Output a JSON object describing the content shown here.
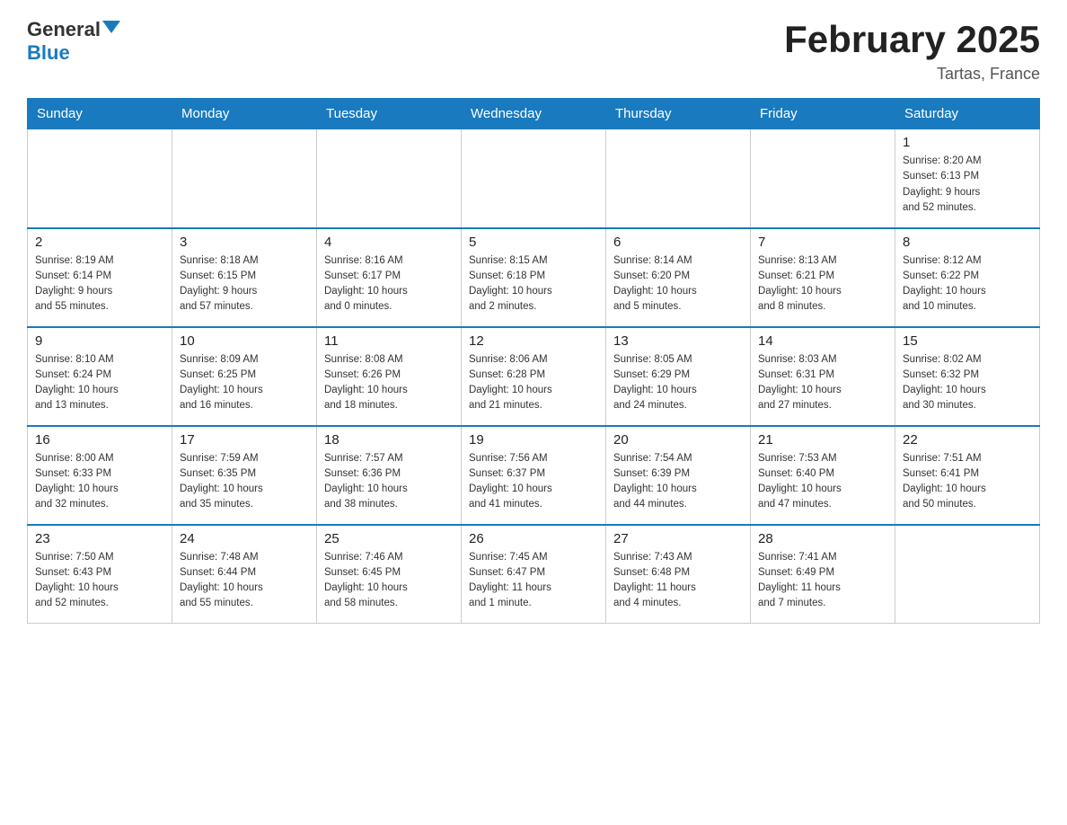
{
  "header": {
    "logo_general": "General",
    "logo_blue": "Blue",
    "month_title": "February 2025",
    "location": "Tartas, France"
  },
  "days_of_week": [
    "Sunday",
    "Monday",
    "Tuesday",
    "Wednesday",
    "Thursday",
    "Friday",
    "Saturday"
  ],
  "weeks": [
    [
      {
        "day": "",
        "info": ""
      },
      {
        "day": "",
        "info": ""
      },
      {
        "day": "",
        "info": ""
      },
      {
        "day": "",
        "info": ""
      },
      {
        "day": "",
        "info": ""
      },
      {
        "day": "",
        "info": ""
      },
      {
        "day": "1",
        "info": "Sunrise: 8:20 AM\nSunset: 6:13 PM\nDaylight: 9 hours\nand 52 minutes."
      }
    ],
    [
      {
        "day": "2",
        "info": "Sunrise: 8:19 AM\nSunset: 6:14 PM\nDaylight: 9 hours\nand 55 minutes."
      },
      {
        "day": "3",
        "info": "Sunrise: 8:18 AM\nSunset: 6:15 PM\nDaylight: 9 hours\nand 57 minutes."
      },
      {
        "day": "4",
        "info": "Sunrise: 8:16 AM\nSunset: 6:17 PM\nDaylight: 10 hours\nand 0 minutes."
      },
      {
        "day": "5",
        "info": "Sunrise: 8:15 AM\nSunset: 6:18 PM\nDaylight: 10 hours\nand 2 minutes."
      },
      {
        "day": "6",
        "info": "Sunrise: 8:14 AM\nSunset: 6:20 PM\nDaylight: 10 hours\nand 5 minutes."
      },
      {
        "day": "7",
        "info": "Sunrise: 8:13 AM\nSunset: 6:21 PM\nDaylight: 10 hours\nand 8 minutes."
      },
      {
        "day": "8",
        "info": "Sunrise: 8:12 AM\nSunset: 6:22 PM\nDaylight: 10 hours\nand 10 minutes."
      }
    ],
    [
      {
        "day": "9",
        "info": "Sunrise: 8:10 AM\nSunset: 6:24 PM\nDaylight: 10 hours\nand 13 minutes."
      },
      {
        "day": "10",
        "info": "Sunrise: 8:09 AM\nSunset: 6:25 PM\nDaylight: 10 hours\nand 16 minutes."
      },
      {
        "day": "11",
        "info": "Sunrise: 8:08 AM\nSunset: 6:26 PM\nDaylight: 10 hours\nand 18 minutes."
      },
      {
        "day": "12",
        "info": "Sunrise: 8:06 AM\nSunset: 6:28 PM\nDaylight: 10 hours\nand 21 minutes."
      },
      {
        "day": "13",
        "info": "Sunrise: 8:05 AM\nSunset: 6:29 PM\nDaylight: 10 hours\nand 24 minutes."
      },
      {
        "day": "14",
        "info": "Sunrise: 8:03 AM\nSunset: 6:31 PM\nDaylight: 10 hours\nand 27 minutes."
      },
      {
        "day": "15",
        "info": "Sunrise: 8:02 AM\nSunset: 6:32 PM\nDaylight: 10 hours\nand 30 minutes."
      }
    ],
    [
      {
        "day": "16",
        "info": "Sunrise: 8:00 AM\nSunset: 6:33 PM\nDaylight: 10 hours\nand 32 minutes."
      },
      {
        "day": "17",
        "info": "Sunrise: 7:59 AM\nSunset: 6:35 PM\nDaylight: 10 hours\nand 35 minutes."
      },
      {
        "day": "18",
        "info": "Sunrise: 7:57 AM\nSunset: 6:36 PM\nDaylight: 10 hours\nand 38 minutes."
      },
      {
        "day": "19",
        "info": "Sunrise: 7:56 AM\nSunset: 6:37 PM\nDaylight: 10 hours\nand 41 minutes."
      },
      {
        "day": "20",
        "info": "Sunrise: 7:54 AM\nSunset: 6:39 PM\nDaylight: 10 hours\nand 44 minutes."
      },
      {
        "day": "21",
        "info": "Sunrise: 7:53 AM\nSunset: 6:40 PM\nDaylight: 10 hours\nand 47 minutes."
      },
      {
        "day": "22",
        "info": "Sunrise: 7:51 AM\nSunset: 6:41 PM\nDaylight: 10 hours\nand 50 minutes."
      }
    ],
    [
      {
        "day": "23",
        "info": "Sunrise: 7:50 AM\nSunset: 6:43 PM\nDaylight: 10 hours\nand 52 minutes."
      },
      {
        "day": "24",
        "info": "Sunrise: 7:48 AM\nSunset: 6:44 PM\nDaylight: 10 hours\nand 55 minutes."
      },
      {
        "day": "25",
        "info": "Sunrise: 7:46 AM\nSunset: 6:45 PM\nDaylight: 10 hours\nand 58 minutes."
      },
      {
        "day": "26",
        "info": "Sunrise: 7:45 AM\nSunset: 6:47 PM\nDaylight: 11 hours\nand 1 minute."
      },
      {
        "day": "27",
        "info": "Sunrise: 7:43 AM\nSunset: 6:48 PM\nDaylight: 11 hours\nand 4 minutes."
      },
      {
        "day": "28",
        "info": "Sunrise: 7:41 AM\nSunset: 6:49 PM\nDaylight: 11 hours\nand 7 minutes."
      },
      {
        "day": "",
        "info": ""
      }
    ]
  ]
}
